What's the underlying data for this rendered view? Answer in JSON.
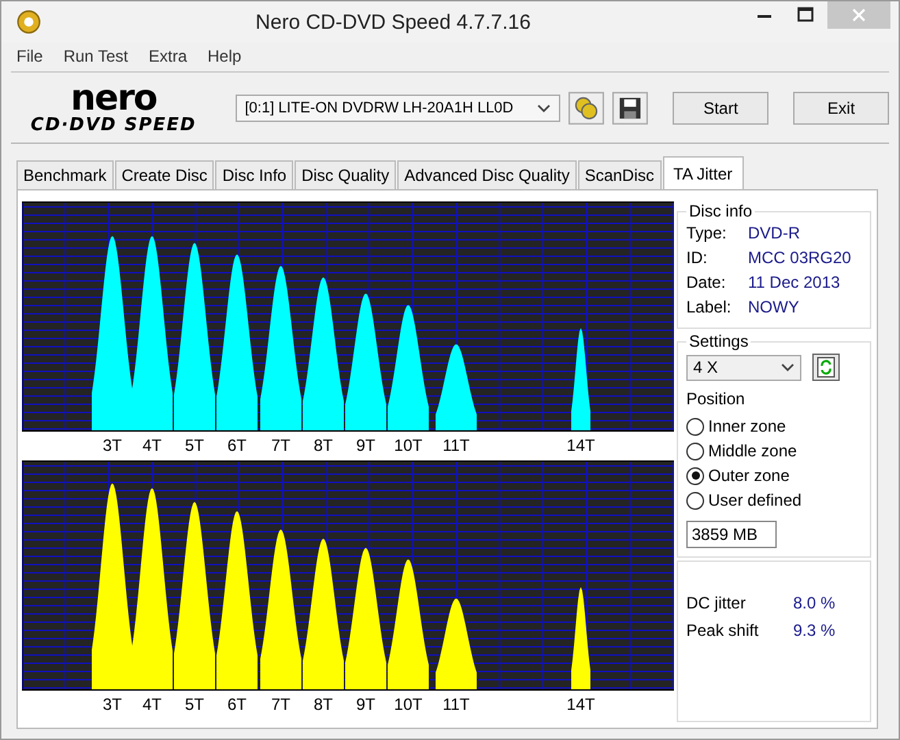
{
  "window": {
    "title": "Nero CD-DVD Speed 4.7.7.16"
  },
  "menu": [
    "File",
    "Run Test",
    "Extra",
    "Help"
  ],
  "logo": {
    "brand": "nero",
    "product": "CD·DVD SPEED"
  },
  "toolbar": {
    "drive": "[0:1]   LITE-ON DVDRW LH-20A1H LL0D",
    "buttons": [
      "Start",
      "Exit"
    ]
  },
  "tabs": [
    {
      "label": "Benchmark",
      "selected": false
    },
    {
      "label": "Create Disc",
      "selected": false
    },
    {
      "label": "Disc Info",
      "selected": false
    },
    {
      "label": "Disc Quality",
      "selected": false
    },
    {
      "label": "Advanced Disc Quality",
      "selected": false
    },
    {
      "label": "ScanDisc",
      "selected": false
    },
    {
      "label": "TA Jitter",
      "selected": true
    }
  ],
  "charts": [
    {
      "kind": "lands",
      "x_labels": [
        "3T",
        "4T",
        "5T",
        "6T",
        "7T",
        "8T",
        "9T",
        "10T",
        "11T",
        "14T"
      ]
    },
    {
      "kind": "pits",
      "x_labels": [
        "3T",
        "4T",
        "5T",
        "6T",
        "7T",
        "8T",
        "9T",
        "10T",
        "11T",
        "14T"
      ]
    }
  ],
  "disc_info": {
    "title": "Disc info",
    "rows": [
      {
        "label": "Type:",
        "value": "DVD-R"
      },
      {
        "label": "ID:",
        "value": "MCC 03RG20"
      },
      {
        "label": "Date:",
        "value": "11 Dec 2013"
      },
      {
        "label": "Label:",
        "value": "NOWY"
      }
    ]
  },
  "settings": {
    "title": "Settings",
    "speed": "4 X",
    "position_label": "Position",
    "positions": [
      {
        "label": "Inner zone",
        "selected": false
      },
      {
        "label": "Middle zone",
        "selected": false
      },
      {
        "label": "Outer zone",
        "selected": true
      },
      {
        "label": "User defined",
        "selected": false
      }
    ],
    "size": "3859 MB"
  },
  "results": [
    {
      "label": "DC jitter",
      "value": "8.0 %"
    },
    {
      "label": "Peak shift",
      "value": "9.3 %"
    }
  ]
}
